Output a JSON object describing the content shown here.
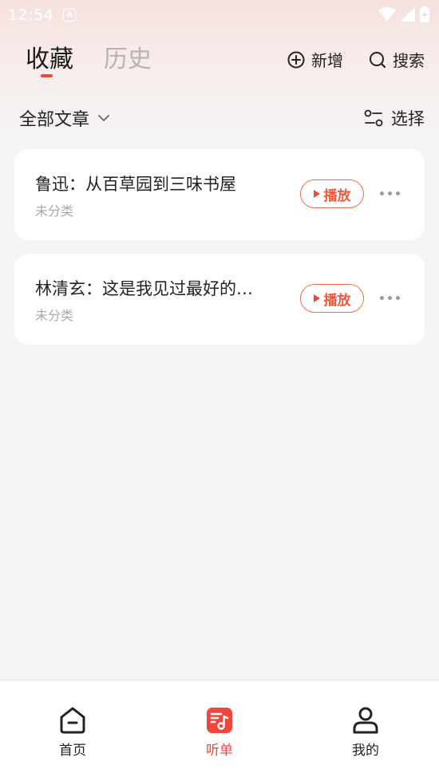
{
  "status_bar": {
    "time": "12:54",
    "a_icon": "A"
  },
  "tabs": [
    {
      "label": "收藏",
      "active": true
    },
    {
      "label": "历史",
      "active": false
    }
  ],
  "header_actions": {
    "add_label": "新增",
    "search_label": "搜索"
  },
  "filter": {
    "category_label": "全部文章",
    "select_label": "选择"
  },
  "articles": [
    {
      "title": "鲁迅：从百草园到三味书屋",
      "category": "未分类",
      "play_label": "播放"
    },
    {
      "title": "林清玄：这是我见过最好的…",
      "category": "未分类",
      "play_label": "播放"
    }
  ],
  "bottom_nav": [
    {
      "label": "首页",
      "icon": "home-icon",
      "active": false
    },
    {
      "label": "听单",
      "icon": "playlist-icon",
      "active": true
    },
    {
      "label": "我的",
      "icon": "profile-icon",
      "active": false
    }
  ],
  "colors": {
    "accent": "#f0463c",
    "background": "#f5f5f6",
    "card": "#ffffff"
  }
}
